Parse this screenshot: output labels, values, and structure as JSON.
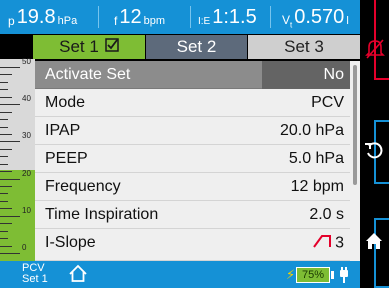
{
  "measurements": [
    {
      "prefix": "p",
      "value": "19.8",
      "unit": "hPa"
    },
    {
      "prefix": "f",
      "value": "12",
      "unit": "bpm"
    },
    {
      "prefix": "I:E",
      "value": "1:1.5",
      "unit": ""
    },
    {
      "prefix": "Vt",
      "value": "0.570",
      "unit": "l"
    }
  ],
  "tabs": [
    {
      "label": "Set 1",
      "active": true,
      "icon": "checkbox-checked-icon"
    },
    {
      "label": "Set 2"
    },
    {
      "label": "Set 3"
    }
  ],
  "gauge": {
    "labels": [
      "50",
      "40",
      "30",
      "20",
      "10",
      "0"
    ],
    "level_percent": 45
  },
  "params": [
    {
      "label": "Activate Set",
      "value": "No"
    },
    {
      "label": "Mode",
      "value": "PCV"
    },
    {
      "label": "IPAP",
      "value": "20.0 hPa"
    },
    {
      "label": "PEEP",
      "value": "5.0 hPa"
    },
    {
      "label": "Frequency",
      "value": "12 bpm"
    },
    {
      "label": "Time Inspiration",
      "value": "2.0 s"
    },
    {
      "label": "I-Slope",
      "value": "3",
      "icon": "rise-slope-icon"
    }
  ],
  "status": {
    "mode_line1": "PCV",
    "mode_line2": "Set 1",
    "battery": "75%"
  },
  "side_buttons": [
    "alarm-silenced-icon",
    "undo-icon",
    "home-icon"
  ],
  "colors": {
    "accent": "#1591d6",
    "set1": "#7ebd34",
    "alarm": "#e4002b"
  }
}
